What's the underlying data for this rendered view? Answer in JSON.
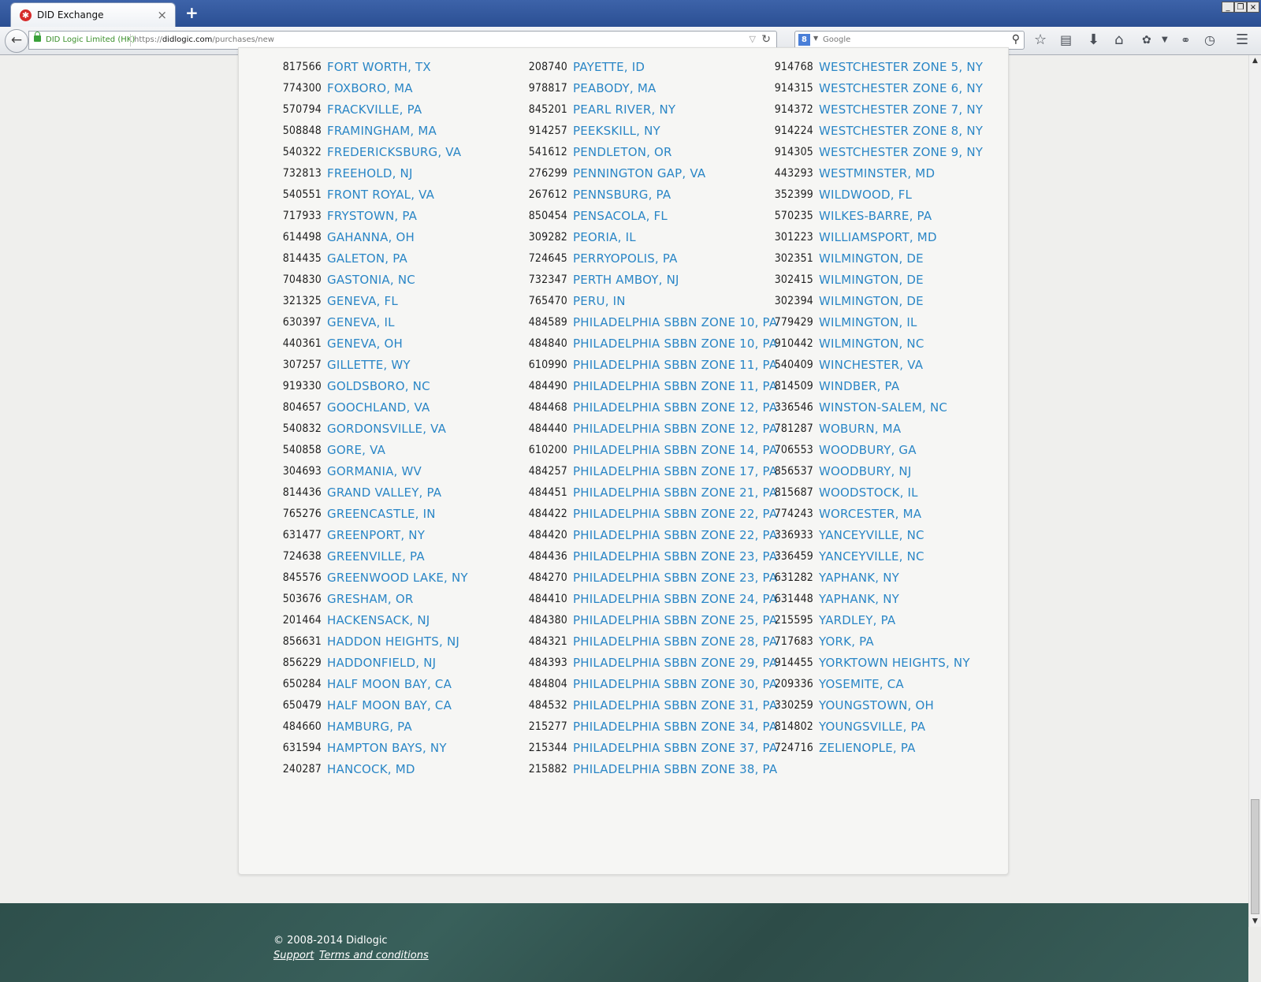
{
  "browser": {
    "tab_title": "DID Exchange",
    "tab_close": "×",
    "new_tab": "+",
    "site_identity": "DID Logic Limited (HK)",
    "url_prefix": "https://",
    "url_domain": "didlogic.com",
    "url_path": "/purchases/new",
    "search_placeholder": "Google",
    "window_buttons": [
      "_",
      "❐",
      "×"
    ]
  },
  "columns": [
    [
      {
        "num": "817566",
        "city": "FORT WORTH, TX"
      },
      {
        "num": "774300",
        "city": "FOXBORO, MA"
      },
      {
        "num": "570794",
        "city": "FRACKVILLE, PA"
      },
      {
        "num": "508848",
        "city": "FRAMINGHAM, MA"
      },
      {
        "num": "540322",
        "city": "FREDERICKSBURG, VA"
      },
      {
        "num": "732813",
        "city": "FREEHOLD, NJ"
      },
      {
        "num": "540551",
        "city": "FRONT ROYAL, VA"
      },
      {
        "num": "717933",
        "city": "FRYSTOWN, PA"
      },
      {
        "num": "614498",
        "city": "GAHANNA, OH"
      },
      {
        "num": "814435",
        "city": "GALETON, PA"
      },
      {
        "num": "704830",
        "city": "GASTONIA, NC"
      },
      {
        "num": "321325",
        "city": "GENEVA, FL"
      },
      {
        "num": "630397",
        "city": "GENEVA, IL"
      },
      {
        "num": "440361",
        "city": "GENEVA, OH"
      },
      {
        "num": "307257",
        "city": "GILLETTE, WY"
      },
      {
        "num": "919330",
        "city": "GOLDSBORO, NC"
      },
      {
        "num": "804657",
        "city": "GOOCHLAND, VA"
      },
      {
        "num": "540832",
        "city": "GORDONSVILLE, VA"
      },
      {
        "num": "540858",
        "city": "GORE, VA"
      },
      {
        "num": "304693",
        "city": "GORMANIA, WV"
      },
      {
        "num": "814436",
        "city": "GRAND VALLEY, PA"
      },
      {
        "num": "765276",
        "city": "GREENCASTLE, IN"
      },
      {
        "num": "631477",
        "city": "GREENPORT, NY"
      },
      {
        "num": "724638",
        "city": "GREENVILLE, PA"
      },
      {
        "num": "845576",
        "city": "GREENWOOD LAKE, NY"
      },
      {
        "num": "503676",
        "city": "GRESHAM, OR"
      },
      {
        "num": "201464",
        "city": "HACKENSACK, NJ"
      },
      {
        "num": "856631",
        "city": "HADDON HEIGHTS, NJ"
      },
      {
        "num": "856229",
        "city": "HADDONFIELD, NJ"
      },
      {
        "num": "650284",
        "city": "HALF MOON BAY, CA"
      },
      {
        "num": "650479",
        "city": "HALF MOON BAY, CA"
      },
      {
        "num": "484660",
        "city": "HAMBURG, PA"
      },
      {
        "num": "631594",
        "city": "HAMPTON BAYS, NY"
      },
      {
        "num": "240287",
        "city": "HANCOCK, MD"
      }
    ],
    [
      {
        "num": "208740",
        "city": "PAYETTE, ID"
      },
      {
        "num": "978817",
        "city": "PEABODY, MA"
      },
      {
        "num": "845201",
        "city": "PEARL RIVER, NY"
      },
      {
        "num": "914257",
        "city": "PEEKSKILL, NY"
      },
      {
        "num": "541612",
        "city": "PENDLETON, OR"
      },
      {
        "num": "276299",
        "city": "PENNINGTON GAP, VA"
      },
      {
        "num": "267612",
        "city": "PENNSBURG, PA"
      },
      {
        "num": "850454",
        "city": "PENSACOLA, FL"
      },
      {
        "num": "309282",
        "city": "PEORIA, IL"
      },
      {
        "num": "724645",
        "city": "PERRYOPOLIS, PA"
      },
      {
        "num": "732347",
        "city": "PERTH AMBOY, NJ"
      },
      {
        "num": "765470",
        "city": "PERU, IN"
      },
      {
        "num": "484589",
        "city": "PHILADELPHIA SBBN ZONE 10, PA"
      },
      {
        "num": "484840",
        "city": "PHILADELPHIA SBBN ZONE 10, PA"
      },
      {
        "num": "610990",
        "city": "PHILADELPHIA SBBN ZONE 11, PA"
      },
      {
        "num": "484490",
        "city": "PHILADELPHIA SBBN ZONE 11, PA"
      },
      {
        "num": "484468",
        "city": "PHILADELPHIA SBBN ZONE 12, PA"
      },
      {
        "num": "484440",
        "city": "PHILADELPHIA SBBN ZONE 12, PA"
      },
      {
        "num": "610200",
        "city": "PHILADELPHIA SBBN ZONE 14, PA"
      },
      {
        "num": "484257",
        "city": "PHILADELPHIA SBBN ZONE 17, PA"
      },
      {
        "num": "484451",
        "city": "PHILADELPHIA SBBN ZONE 21, PA"
      },
      {
        "num": "484422",
        "city": "PHILADELPHIA SBBN ZONE 22, PA"
      },
      {
        "num": "484420",
        "city": "PHILADELPHIA SBBN ZONE 22, PA"
      },
      {
        "num": "484436",
        "city": "PHILADELPHIA SBBN ZONE 23, PA"
      },
      {
        "num": "484270",
        "city": "PHILADELPHIA SBBN ZONE 23, PA"
      },
      {
        "num": "484410",
        "city": "PHILADELPHIA SBBN ZONE 24, PA"
      },
      {
        "num": "484380",
        "city": "PHILADELPHIA SBBN ZONE 25, PA"
      },
      {
        "num": "484321",
        "city": "PHILADELPHIA SBBN ZONE 28, PA"
      },
      {
        "num": "484393",
        "city": "PHILADELPHIA SBBN ZONE 29, PA"
      },
      {
        "num": "484804",
        "city": "PHILADELPHIA SBBN ZONE 30, PA"
      },
      {
        "num": "484532",
        "city": "PHILADELPHIA SBBN ZONE 31, PA"
      },
      {
        "num": "215277",
        "city": "PHILADELPHIA SBBN ZONE 34, PA"
      },
      {
        "num": "215344",
        "city": "PHILADELPHIA SBBN ZONE 37, PA"
      },
      {
        "num": "215882",
        "city": "PHILADELPHIA SBBN ZONE 38, PA"
      }
    ],
    [
      {
        "num": "914768",
        "city": "WESTCHESTER ZONE 5, NY"
      },
      {
        "num": "914315",
        "city": "WESTCHESTER ZONE 6, NY"
      },
      {
        "num": "914372",
        "city": "WESTCHESTER ZONE 7, NY"
      },
      {
        "num": "914224",
        "city": "WESTCHESTER ZONE 8, NY"
      },
      {
        "num": "914305",
        "city": "WESTCHESTER ZONE 9, NY"
      },
      {
        "num": "443293",
        "city": "WESTMINSTER, MD"
      },
      {
        "num": "352399",
        "city": "WILDWOOD, FL"
      },
      {
        "num": "570235",
        "city": "WILKES-BARRE, PA"
      },
      {
        "num": "301223",
        "city": "WILLIAMSPORT, MD"
      },
      {
        "num": "302351",
        "city": "WILMINGTON, DE"
      },
      {
        "num": "302415",
        "city": "WILMINGTON, DE"
      },
      {
        "num": "302394",
        "city": "WILMINGTON, DE"
      },
      {
        "num": "779429",
        "city": "WILMINGTON, IL"
      },
      {
        "num": "910442",
        "city": "WILMINGTON, NC"
      },
      {
        "num": "540409",
        "city": "WINCHESTER, VA"
      },
      {
        "num": "814509",
        "city": "WINDBER, PA"
      },
      {
        "num": "336546",
        "city": "WINSTON-SALEM, NC"
      },
      {
        "num": "781287",
        "city": "WOBURN, MA"
      },
      {
        "num": "706553",
        "city": "WOODBURY, GA"
      },
      {
        "num": "856537",
        "city": "WOODBURY, NJ"
      },
      {
        "num": "815687",
        "city": "WOODSTOCK, IL"
      },
      {
        "num": "774243",
        "city": "WORCESTER, MA"
      },
      {
        "num": "336933",
        "city": "YANCEYVILLE, NC"
      },
      {
        "num": "336459",
        "city": "YANCEYVILLE, NC"
      },
      {
        "num": "631282",
        "city": "YAPHANK, NY"
      },
      {
        "num": "631448",
        "city": "YAPHANK, NY"
      },
      {
        "num": "215595",
        "city": "YARDLEY, PA"
      },
      {
        "num": "717683",
        "city": "YORK, PA"
      },
      {
        "num": "914455",
        "city": "YORKTOWN HEIGHTS, NY"
      },
      {
        "num": "209336",
        "city": "YOSEMITE, CA"
      },
      {
        "num": "330259",
        "city": "YOUNGSTOWN, OH"
      },
      {
        "num": "814802",
        "city": "YOUNGSVILLE, PA"
      },
      {
        "num": "724716",
        "city": "ZELIENOPLE, PA"
      }
    ]
  ],
  "footer": {
    "copyright": "© 2008-2014 Didlogic",
    "support": "Support",
    "terms": "Terms and conditions"
  },
  "colors": {
    "link": "#2a86c6",
    "footer_bg": "#2e4f4b",
    "titlebar": "#2b4f93"
  }
}
